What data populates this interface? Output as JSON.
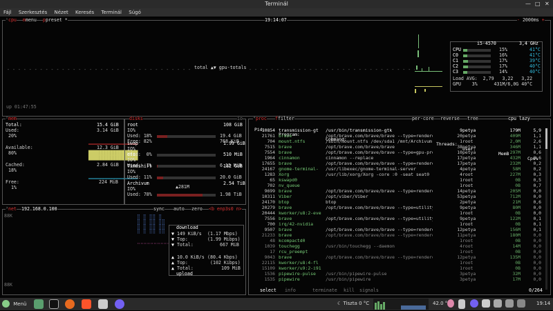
{
  "window": {
    "title": "Terminál"
  },
  "menu": [
    "Fájl",
    "Szerkesztés",
    "Nézet",
    "Keresés",
    "Terminál",
    "Súgó"
  ],
  "cpu_panel": {
    "label": "cpu",
    "menu": "menu",
    "preset": "preset *",
    "time": "19:14:07",
    "interval": "2000ms",
    "graph_label": "total ▲▼ gpu-totals",
    "uptime": "up 01:47:55",
    "cpu_model": "i5-4570",
    "freq": "3,4 GHz",
    "cores": [
      {
        "name": "CPU",
        "pct": "15%",
        "temp": "41°C",
        "fill": 0.15
      },
      {
        "name": "C0",
        "pct": "16%",
        "temp": "41°C",
        "fill": 0.16
      },
      {
        "name": "C1",
        "pct": "17%",
        "temp": "39°C",
        "fill": 0.17
      },
      {
        "name": "C2",
        "pct": "17%",
        "temp": "40°C",
        "fill": 0.17
      },
      {
        "name": "C3",
        "pct": "14%",
        "temp": "40°C",
        "fill": 0.14
      }
    ],
    "load_avg": "Load AVG:  2,79   3,22   3,22",
    "gpu": "GPU    3%      431M/6,0G 40°C"
  },
  "mem_panel": {
    "label": "mem",
    "total_label": "Total:",
    "total": "15.4 GiB",
    "used_label": "Used:",
    "used": "3.14 GiB",
    "used_pct": "20%",
    "available_label": "Available:",
    "available": "12.3 GiB",
    "available_pct": "80%",
    "cached_label": "Cached:",
    "cached": "2.84 GiB",
    "cached_pct": "18%",
    "free_label": "Free:",
    "free": "224 MiB",
    "free_pct": "1%"
  },
  "disks_panel": {
    "label": "disks",
    "io_label": "▼60K",
    "disks": [
      {
        "name": "root",
        "size": "108 GiB",
        "io": "IO%",
        "used_label": "Used: 18%",
        "used": "19.4 GiB",
        "free_label": "Free: 82%",
        "free": "768 KiB",
        "fill": 0.18
      },
      {
        "name": "swap",
        "size": "1.99 GiB",
        "io": "IO%",
        "used_label": "Used:  0%",
        "used": "",
        "free_label": "",
        "free": "",
        "fill": 0.0
      },
      {
        "name": "efi",
        "size": "510 MiB",
        "io": "IO%",
        "used_label": "Used:  1%",
        "used": "6.13 MiB",
        "free_label": "",
        "free": "",
        "fill": 0.01
      },
      {
        "name": "Timeshift",
        "size": "182 GiB",
        "io": "IO%",
        "used_label": "Used: 11%",
        "used": "20.0 GiB",
        "free_label": "",
        "free": "",
        "fill": 0.11
      },
      {
        "name": "Archivum",
        "size": "2.54 TiB",
        "io": "IO%",
        "used_label": "Used: 78%",
        "used": "1.98 TiB",
        "free_label": "",
        "free": "",
        "fill": 0.78
      }
    ],
    "archivum_io": "▲281M"
  },
  "net_panel": {
    "label": "net",
    "ip": "192.168.0.100",
    "sync": "sync",
    "auto": "auto",
    "zero": "zero",
    "iface": "<b enp3s0 n>",
    "scale_top": "88K",
    "scale_bottom": "88K",
    "download_label": "download",
    "download": [
      {
        "sym": "▼",
        "text": "149 KiB/s",
        "extra": "(1.17 Mbps)"
      },
      {
        "sym": "▼",
        "text": "Top:",
        "extra": "(1.99 Mibps)"
      },
      {
        "sym": "▼",
        "text": "Total:",
        "extra": "667 MiB"
      }
    ],
    "upload_label": "upload",
    "upload": [
      {
        "sym": "▲",
        "text": "10.0 KiB/s",
        "extra": "(80.4 Kbps)"
      },
      {
        "sym": "▲",
        "text": "Top:",
        "extra": "(102 Kibps)"
      },
      {
        "sym": "▲",
        "text": "Total:",
        "extra": "109 MiB"
      }
    ]
  },
  "proc_panel": {
    "label": "proc",
    "filter": "filter",
    "per_core": "per-core",
    "reverse": "reverse",
    "tree": "tree",
    "sort": "cpu lazy",
    "headers": {
      "pid": "Pid:",
      "program": "Program:",
      "command": "Command:",
      "threads": "Threads:",
      "user": "User:",
      "mem": "MemB",
      "cpu": "Cpu%"
    },
    "rows": [
      {
        "pid": "10854",
        "program": "transmission-gt",
        "command": "/usr/bin/transmission-gtk",
        "threads": "9",
        "user": "petya",
        "mem": "179M",
        "cpu": "5,9"
      },
      {
        "pid": "21761",
        "program": "brave",
        "command": "/opt/brave.com/brave/brave --type=rendere",
        "threads": "20",
        "user": "petya",
        "mem": "409M",
        "cpu": "1,1"
      },
      {
        "pid": "704",
        "program": "mount.ntfs",
        "command": "/sbin/mount.ntfs /dev/sda1 /mnt/Archivum",
        "threads": "1",
        "user": "root",
        "mem": "2,0M",
        "cpu": "2,6"
      },
      {
        "pid": "7515",
        "program": "brave",
        "command": "/opt/brave.com/brave/brave",
        "threads": "38",
        "user": "petya",
        "mem": "346M",
        "cpu": "1,1"
      },
      {
        "pid": "7554",
        "program": "brave",
        "command": "/opt/brave.com/brave/brave --type=gpu-pro",
        "threads": "10",
        "user": "petya",
        "mem": "297M",
        "cpu": "0,6"
      },
      {
        "pid": "1964",
        "program": "cinnamon",
        "command": "cinnamon --replace",
        "threads": "17",
        "user": "petya",
        "mem": "432M",
        "cpu": "0,6"
      },
      {
        "pid": "17655",
        "program": "brave",
        "command": "/opt/brave.com/brave/brave --type=rendere",
        "threads": "17",
        "user": "petya",
        "mem": "232M",
        "cpu": "0,2"
      },
      {
        "pid": "24167",
        "program": "gnome-terminal-",
        "command": "/usr/libexec/gnome-terminal-server",
        "threads": "4",
        "user": "petya",
        "mem": "58M",
        "cpu": "0,2"
      },
      {
        "pid": "1283",
        "program": "Xorg",
        "command": "/usr/lib/xorg/Xorg -core :0 -seat seat0 -",
        "threads": "4",
        "user": "root",
        "mem": "227M",
        "cpu": "0,3"
      },
      {
        "pid": "65",
        "program": "kswapd0",
        "command": "",
        "threads": "1",
        "user": "root",
        "mem": "0B",
        "cpu": "0,5"
      },
      {
        "pid": "702",
        "program": "nv_queue",
        "command": "",
        "threads": "1",
        "user": "root",
        "mem": "0B",
        "cpu": "0,7"
      },
      {
        "pid": "9699",
        "program": "brave",
        "command": "/opt/brave.com/brave/brave --type=rendere",
        "threads": "14",
        "user": "petya",
        "mem": "205M",
        "cpu": "0,0"
      },
      {
        "pid": "10311",
        "program": "Viber",
        "command": "/opt/viber/Viber",
        "threads": "53",
        "user": "petya",
        "mem": "712M",
        "cpu": "0,0"
      },
      {
        "pid": "24170",
        "program": "btop",
        "command": "btop",
        "threads": "2",
        "user": "petya",
        "mem": "21M",
        "cpu": "0,6"
      },
      {
        "pid": "20279",
        "program": "brave",
        "command": "/opt/brave.com/brave/brave --type=utility",
        "threads": "9",
        "user": "petya",
        "mem": "80M",
        "cpu": "0,0"
      },
      {
        "pid": "20444",
        "program": "kworker/u8:2-eve",
        "command": "",
        "threads": "1",
        "user": "root",
        "mem": "0B",
        "cpu": "0,0"
      },
      {
        "pid": "7556",
        "program": "brave",
        "command": "/opt/brave.com/brave/brave --type=utility",
        "threads": "9",
        "user": "petya",
        "mem": "122M",
        "cpu": "0,1"
      },
      {
        "pid": "700",
        "program": "irq/42-nvidia",
        "command": "",
        "threads": "1",
        "user": "root",
        "mem": "0B",
        "cpu": "0,1"
      },
      {
        "pid": "9507",
        "program": "brave",
        "command": "/opt/brave.com/brave/brave --type=rendere",
        "threads": "12",
        "user": "petya",
        "mem": "156M",
        "cpu": "0,1"
      },
      {
        "pid": "21233",
        "program": "brave",
        "command": "/opt/brave.com/brave/brave --type=rendere",
        "threads": "11",
        "user": "petya",
        "mem": "180M",
        "cpu": "0,0"
      },
      {
        "pid": "48",
        "program": "kcompactd0",
        "command": "",
        "threads": "1",
        "user": "root",
        "mem": "0B",
        "cpu": "0,0"
      },
      {
        "pid": "1039",
        "program": "touchegg",
        "command": "/usr/bin/touchegg --daemon",
        "threads": "4",
        "user": "root",
        "mem": "14M",
        "cpu": "0,0"
      },
      {
        "pid": "17",
        "program": "rcu_preempt",
        "command": "",
        "threads": "1",
        "user": "root",
        "mem": "0B",
        "cpu": "0,0"
      },
      {
        "pid": "9043",
        "program": "brave",
        "command": "/opt/brave.com/brave/brave --type=rendere",
        "threads": "12",
        "user": "petya",
        "mem": "135M",
        "cpu": "0,0"
      },
      {
        "pid": "22115",
        "program": "kworker/u8:4-fl",
        "command": "",
        "threads": "1",
        "user": "root",
        "mem": "0B",
        "cpu": "0,0"
      },
      {
        "pid": "15109",
        "program": "kworker/u9:2-i91",
        "command": "",
        "threads": "1",
        "user": "root",
        "mem": "0B",
        "cpu": "0,0"
      },
      {
        "pid": "1536",
        "program": "pipewire-pulse",
        "command": "/usr/bin/pipewire-pulse",
        "threads": "3",
        "user": "petya",
        "mem": "32M",
        "cpu": "0,0"
      },
      {
        "pid": "1535",
        "program": "pipewire",
        "command": "/usr/bin/pipewire",
        "threads": "3",
        "user": "petya",
        "mem": "17M",
        "cpu": "0,0"
      }
    ],
    "footer_select": "select",
    "footer_info": "info",
    "footer_terminate": "terminate",
    "footer_kill": "kill",
    "footer_signals": "signals",
    "count": "0/264"
  },
  "taskbar": {
    "menu_label": "Menü",
    "weather": "Tiszta 0 °C",
    "temp": "42.0 °",
    "clock": "19:14"
  },
  "colors": {
    "accent": "#d33333",
    "bar": "#7a2020",
    "green": "#66cc66",
    "cyan": "#33bbdd"
  }
}
